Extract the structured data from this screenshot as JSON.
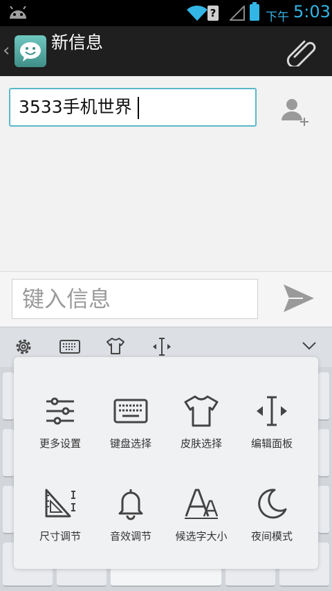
{
  "status_bar": {
    "period": "下午",
    "time": "5:03"
  },
  "action_bar": {
    "title": "新信息",
    "back_icon": "chevron-left-icon",
    "app_icon": "sms-smiley-icon",
    "attach_icon": "paperclip-icon"
  },
  "recipient": {
    "value": "3533手机世界"
  },
  "compose": {
    "placeholder": "键入信息",
    "send_icon": "send-icon"
  },
  "keyboard_toolbar": {
    "icons": [
      "gear-icon",
      "keyboard-icon",
      "tshirt-icon",
      "cursor-resize-icon",
      "chevron-down-icon"
    ]
  },
  "panel": {
    "items": [
      {
        "label": "更多设置",
        "icon": "sliders-icon"
      },
      {
        "label": "键盘选择",
        "icon": "keyboard-icon"
      },
      {
        "label": "皮肤选择",
        "icon": "tshirt-icon"
      },
      {
        "label": "编辑面板",
        "icon": "cursor-edit-icon"
      },
      {
        "label": "尺寸调节",
        "icon": "ruler-triangle-icon"
      },
      {
        "label": "音效调节",
        "icon": "bell-icon"
      },
      {
        "label": "候选字大小",
        "icon": "font-size-icon"
      },
      {
        "label": "夜间模式",
        "icon": "moon-icon"
      }
    ]
  },
  "colors": {
    "accent": "#33b5e5",
    "field_border": "#5ab8c9",
    "icon_dark": "#444444"
  }
}
